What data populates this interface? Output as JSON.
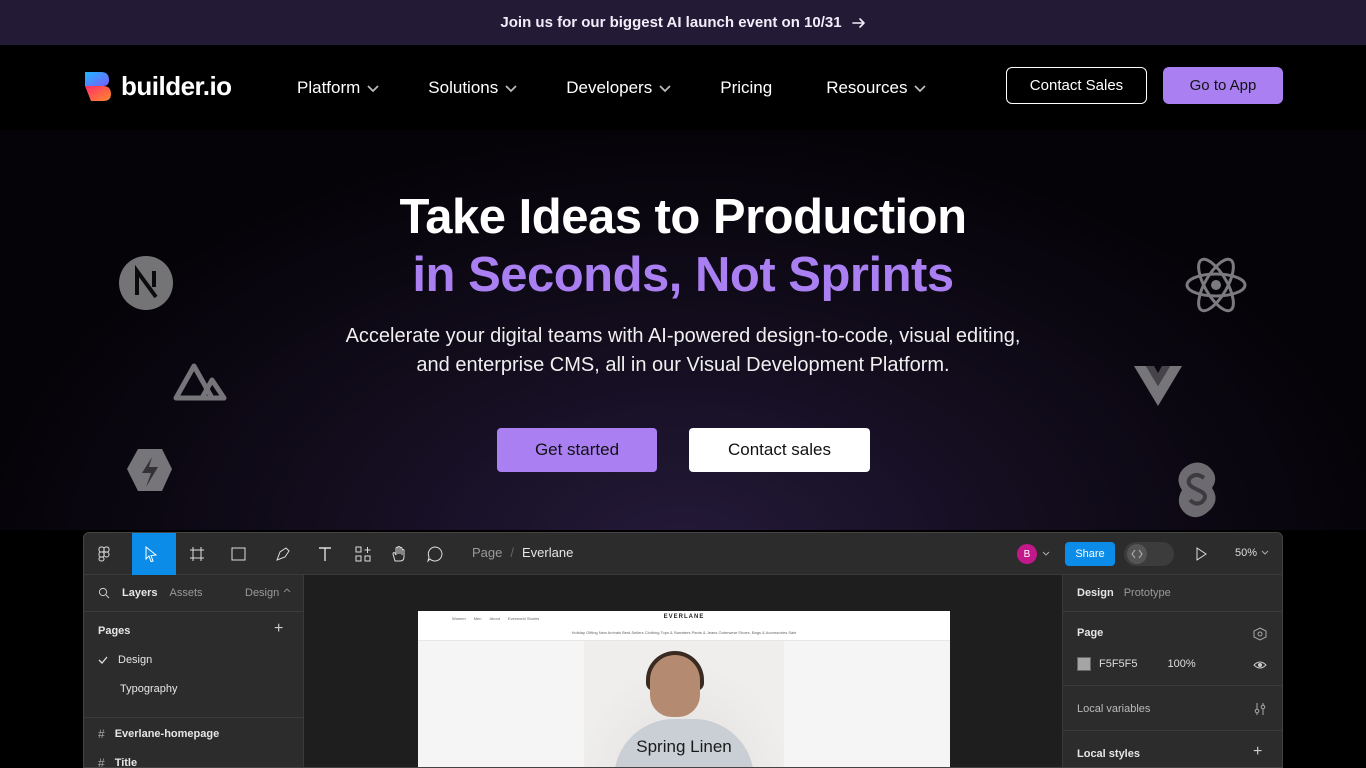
{
  "announcement": {
    "text": "Join us for our biggest AI launch event on 10/31"
  },
  "header": {
    "logo_text": "builder.io",
    "menu": [
      {
        "label": "Platform",
        "has_dropdown": true
      },
      {
        "label": "Solutions",
        "has_dropdown": true
      },
      {
        "label": "Developers",
        "has_dropdown": true
      },
      {
        "label": "Pricing",
        "has_dropdown": false
      },
      {
        "label": "Resources",
        "has_dropdown": true
      }
    ],
    "contact_sales_label": "Contact Sales",
    "go_to_app_label": "Go to App"
  },
  "hero": {
    "title_line1": "Take Ideas to Production",
    "title_line2": "in Seconds, Not Sprints",
    "subtitle": "Accelerate your digital teams with AI-powered design-to-code, visual editing, and enterprise CMS, all in our Visual Development Platform.",
    "get_started_label": "Get started",
    "contact_sales_label": "Contact sales"
  },
  "colors": {
    "accent": "#a97ff2",
    "banner_bg": "#231a35",
    "figma_blue": "#0c8ce9"
  },
  "editor": {
    "breadcrumb": {
      "root": "Page",
      "separator": "/",
      "current": "Everlane"
    },
    "avatar_initial": "B",
    "share_label": "Share",
    "zoom_label": "50%",
    "left_panel": {
      "tabs": [
        "Layers",
        "Assets"
      ],
      "design_label": "Design",
      "pages_title": "Pages",
      "pages": [
        {
          "label": "Design",
          "checked": true
        },
        {
          "label": "Typography",
          "checked": false
        }
      ],
      "layers": [
        {
          "label": "Everlane-homepage"
        },
        {
          "label": "Title"
        }
      ]
    },
    "canvas": {
      "site_brand": "EVERLANE",
      "site_nav": [
        "Women",
        "Men",
        "About",
        "Everworld Stories"
      ],
      "site_subnav": "Holiday Gifting   New Arrivals   Best-Sellers   Clothing   Tops & Sweaters   Pants & Jeans   Outerwear   Shoes, Bags & Accessories   Sale",
      "hero_caption": "Spring Linen"
    },
    "right_panel": {
      "tabs": [
        "Design",
        "Prototype"
      ],
      "page_title": "Page",
      "page_color_hex": "F5F5F5",
      "page_opacity": "100%",
      "local_variables_label": "Local variables",
      "local_styles_label": "Local styles"
    }
  }
}
